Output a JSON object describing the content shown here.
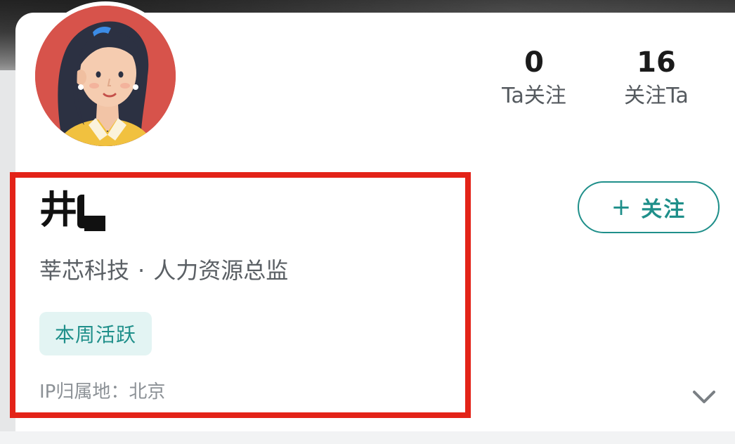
{
  "profile": {
    "name": "井",
    "company": "莘芯科技",
    "separator": "·",
    "position": "人力资源总监",
    "badge": "本周活跃",
    "ip_location": "IP归属地：北京"
  },
  "stats": {
    "following": {
      "count": "0",
      "label": "Ta关注"
    },
    "followers": {
      "count": "16",
      "label": "关注Ta"
    }
  },
  "actions": {
    "follow_plus": "+",
    "follow_label": "关注"
  },
  "icons": {
    "avatar": "avatar-illustration-woman",
    "expand": "chevron-down-icon"
  },
  "colors": {
    "accent": "#1f8f8a",
    "badge_bg": "#e3f4f3",
    "highlight": "#e32318",
    "avatar_bg": "#d7534b"
  }
}
